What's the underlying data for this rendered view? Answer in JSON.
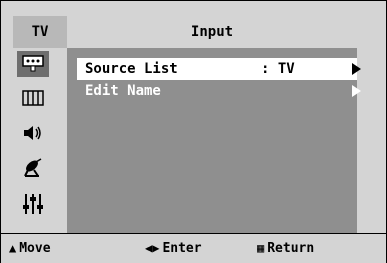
{
  "osd": {
    "source_tab": "TV",
    "title": "Input"
  },
  "sidebar": {
    "items": [
      {
        "icon": "input-icon",
        "active": true
      },
      {
        "icon": "picture-icon",
        "active": false
      },
      {
        "icon": "sound-icon",
        "active": false
      },
      {
        "icon": "channel-icon",
        "active": false
      },
      {
        "icon": "setup-icon",
        "active": false
      }
    ]
  },
  "menu": {
    "rows": [
      {
        "label": "Source List",
        "value": ": TV",
        "selected": true
      },
      {
        "label": "Edit Name",
        "value": "",
        "selected": false
      }
    ]
  },
  "footer": {
    "move_label": "Move",
    "enter_label": "Enter",
    "return_label": "Return"
  },
  "colors": {
    "frame": "#d4d4d4",
    "panel": "#8f8f8f",
    "tab": "#b8b8b8",
    "active_icon_bg": "#6e6e6e",
    "selected_row": "#ffffff"
  }
}
